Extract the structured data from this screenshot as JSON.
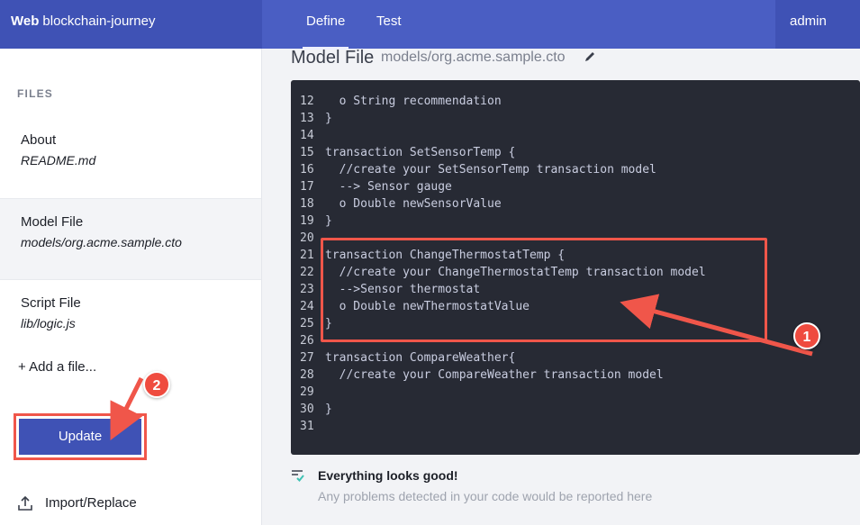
{
  "header": {
    "brand_bold": "Web",
    "brand_name": "blockchain-journey",
    "tabs": [
      {
        "label": "Define"
      },
      {
        "label": "Test"
      }
    ],
    "user": "admin"
  },
  "sidebar": {
    "files_title": "FILES",
    "files": [
      {
        "name": "About",
        "path": "README.md"
      },
      {
        "name": "Model File",
        "path": "models/org.acme.sample.cto"
      },
      {
        "name": "Script File",
        "path": "lib/logic.js"
      }
    ],
    "add_file": "+ Add a file...",
    "update_label": "Update",
    "import_label": "Import/Replace"
  },
  "main": {
    "title": "Model File",
    "path": "models/org.acme.sample.cto"
  },
  "editor": {
    "lines": [
      {
        "n": "12",
        "code": "  o String recommendation"
      },
      {
        "n": "13",
        "code": "}"
      },
      {
        "n": "14",
        "code": ""
      },
      {
        "n": "15",
        "code": "transaction SetSensorTemp {"
      },
      {
        "n": "16",
        "code": "  //create your SetSensorTemp transaction model"
      },
      {
        "n": "17",
        "code": "  --> Sensor gauge"
      },
      {
        "n": "18",
        "code": "  o Double newSensorValue"
      },
      {
        "n": "19",
        "code": "}"
      },
      {
        "n": "20",
        "code": ""
      },
      {
        "n": "21",
        "code": "transaction ChangeThermostatTemp {"
      },
      {
        "n": "22",
        "code": "  //create your ChangeThermostatTemp transaction model"
      },
      {
        "n": "23",
        "code": "  -->Sensor thermostat"
      },
      {
        "n": "24",
        "code": "  o Double newThermostatValue"
      },
      {
        "n": "25",
        "code": "}"
      },
      {
        "n": "26",
        "code": ""
      },
      {
        "n": "27",
        "code": "transaction CompareWeather{"
      },
      {
        "n": "28",
        "code": "  //create your CompareWeather transaction model"
      },
      {
        "n": "29",
        "code": ""
      },
      {
        "n": "30",
        "code": "}"
      },
      {
        "n": "31",
        "code": ""
      }
    ]
  },
  "status": {
    "title": "Everything looks good!",
    "subtitle": "Any problems detected in your code would be reported here"
  },
  "annotations": {
    "badge1": "1",
    "badge2": "2",
    "color": "#f0564a"
  },
  "colors": {
    "header": "#4a5ec3",
    "brand": "#3f52b5",
    "editor_bg": "#272a34",
    "accent_red": "#ef4b3f"
  }
}
